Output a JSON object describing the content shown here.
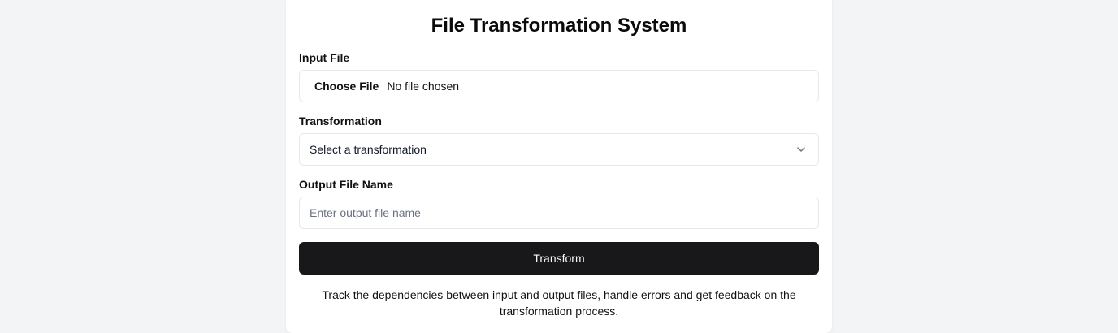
{
  "app": {
    "title": "File Transformation System"
  },
  "form": {
    "input_file": {
      "label": "Input File",
      "button_label": "Choose File",
      "status": "No file chosen"
    },
    "transformation": {
      "label": "Transformation",
      "selected": "Select a transformation",
      "icon": "chevron-down-icon"
    },
    "output_file_name": {
      "label": "Output File Name",
      "placeholder": "Enter output file name",
      "value": ""
    },
    "submit_label": "Transform"
  },
  "footer": {
    "description": "Track the dependencies between input and output files, handle errors and get feedback on the transformation process."
  },
  "colors": {
    "page_background": "#f3f4f6",
    "card_background": "#ffffff",
    "button_background": "#18181b",
    "button_text": "#fafafa",
    "border": "#e5e7eb",
    "placeholder": "#6b7280"
  }
}
